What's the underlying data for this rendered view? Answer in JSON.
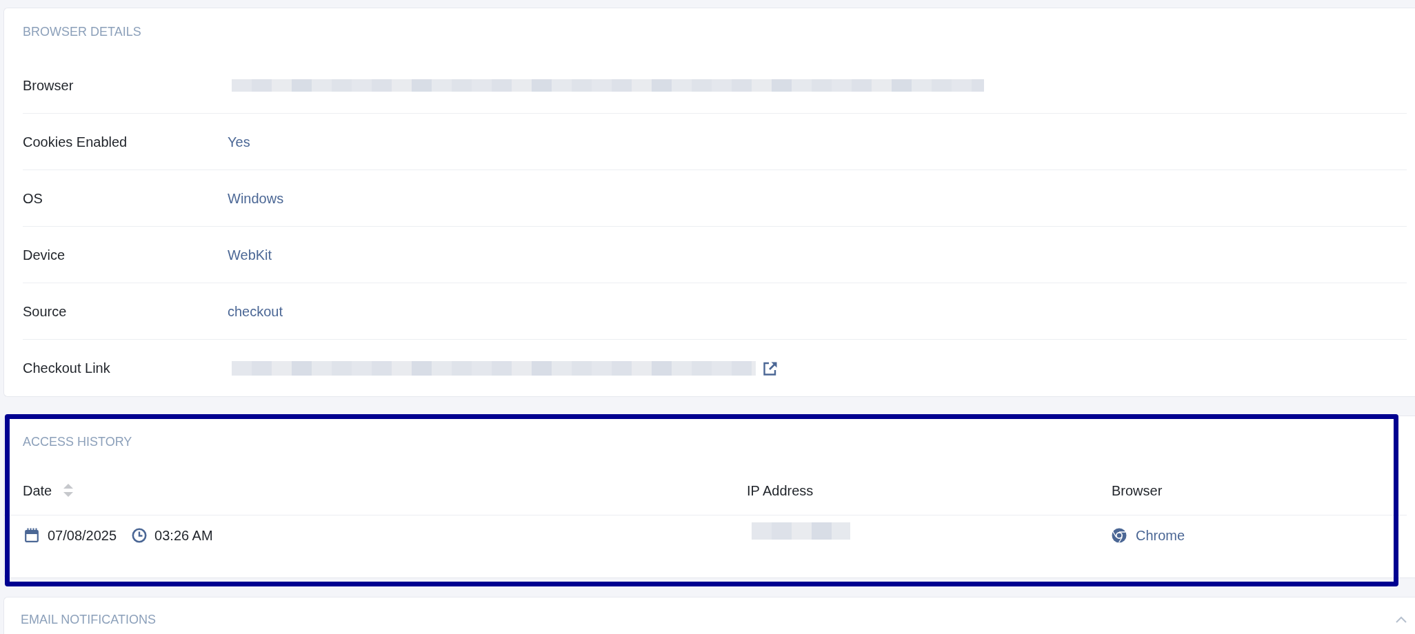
{
  "browser_details": {
    "title": "BROWSER DETAILS",
    "rows": [
      {
        "label": "Browser",
        "kind": "redacted"
      },
      {
        "label": "Cookies Enabled",
        "kind": "text",
        "value": "Yes"
      },
      {
        "label": "OS",
        "kind": "text",
        "value": "Windows"
      },
      {
        "label": "Device",
        "kind": "text",
        "value": "WebKit"
      },
      {
        "label": "Source",
        "kind": "text",
        "value": "checkout"
      },
      {
        "label": "Checkout Link",
        "kind": "redacted_link"
      }
    ]
  },
  "access_history": {
    "title": "ACCESS HISTORY",
    "highlighted": true,
    "columns": [
      {
        "label": "Date",
        "sortable": true
      },
      {
        "label": "IP Address",
        "sortable": false
      },
      {
        "label": "Browser",
        "sortable": false
      }
    ],
    "rows": [
      {
        "cells": [
          {
            "kind": "datetime",
            "date": "07/08/2025",
            "time": "03:26 AM"
          },
          {
            "kind": "redacted"
          },
          {
            "kind": "browser",
            "text": "Chrome"
          }
        ]
      }
    ]
  },
  "email_notifications": {
    "title": "EMAIL NOTIFICATIONS",
    "expanded": true
  }
}
